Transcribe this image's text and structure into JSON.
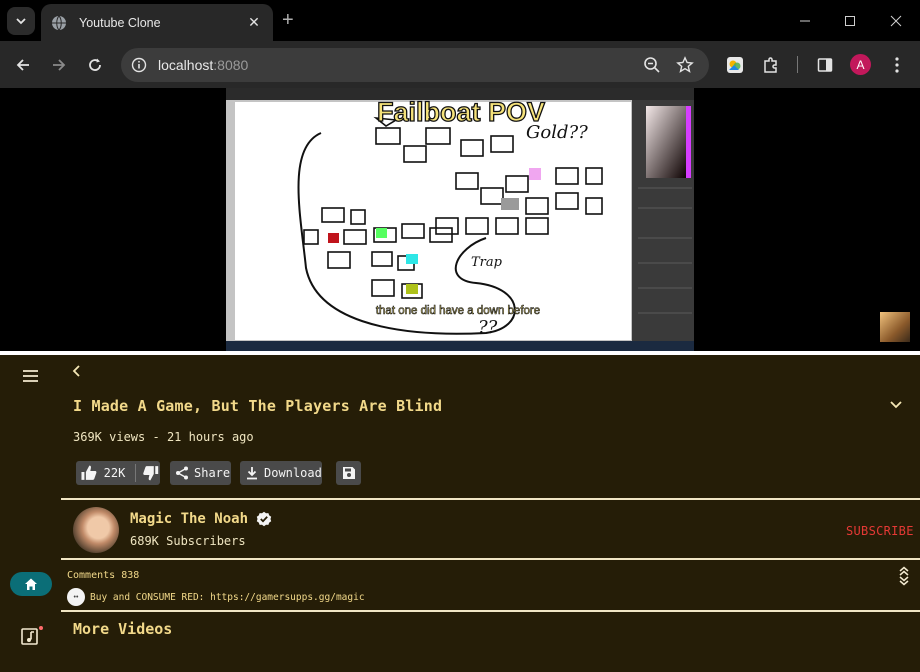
{
  "browser": {
    "tab_title": "Youtube Clone",
    "url_host": "localhost",
    "url_port": ":8080"
  },
  "video": {
    "overlay_title": "Failboat POV",
    "caption": "that one did have a down before",
    "sketch_labels": [
      "Gold??",
      "Trap",
      "??"
    ],
    "title": "I Made A Game, But The Players Are Blind",
    "views": "369K views",
    "age": "21 hours ago",
    "meta_sep": " - "
  },
  "actions": {
    "like_count": "22K",
    "share_label": "Share",
    "download_label": "Download"
  },
  "channel": {
    "name": "Magic The Noah",
    "subscribers": "689K Subscribers",
    "subscribe_label": "SUBSCRIBE"
  },
  "comments": {
    "header_label": "Comments",
    "count": "838",
    "top_comment": "Buy and CONSUME RED: https://gamersupps.gg/magic",
    "avatar_glyph": "••"
  },
  "sections": {
    "more_videos": "More Videos"
  },
  "colors": {
    "page_bg": "#251d07",
    "accent_text": "#f2d98a",
    "subscribe": "#e53935",
    "home_active": "#0b6e77"
  },
  "icons": [
    "chevron-down-icon",
    "globe-icon",
    "close-icon",
    "plus-icon",
    "minimize-icon",
    "maximize-icon",
    "back-arrow-icon",
    "forward-arrow-icon",
    "reload-icon",
    "info-icon",
    "zoom-out-icon",
    "star-icon",
    "extension-icon",
    "puzzle-icon",
    "sidepanel-icon",
    "kebab-icon",
    "hamburger-icon",
    "home-icon",
    "music-library-icon",
    "chevron-left-icon",
    "thumbs-up-icon",
    "thumbs-down-icon",
    "share-icon",
    "download-icon",
    "save-icon",
    "verified-icon",
    "expand-collapse-icon"
  ]
}
